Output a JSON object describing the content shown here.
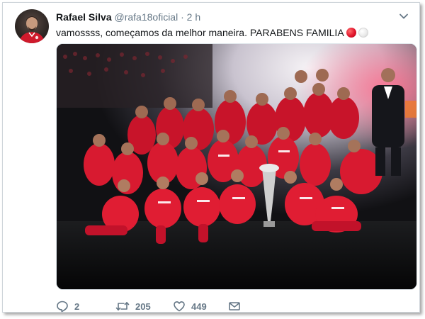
{
  "tweet": {
    "author": {
      "display_name": "Rafael Silva",
      "handle": "@rafa18oficial"
    },
    "separator": "·",
    "time": "2 h",
    "text": "vamossss, começamos da melhor maneira. PARABENS FAMILIA",
    "emoji": [
      "red-circle",
      "white-circle"
    ],
    "media": {
      "type": "photo",
      "subject": "team celebration with trophy"
    },
    "actions": {
      "reply_count": "2",
      "retweet_count": "205",
      "like_count": "449"
    }
  },
  "colors": {
    "text_primary": "#14171a",
    "text_secondary": "#657786",
    "kit_red": "#d4142a",
    "border": "#e1e8ed"
  },
  "icons": {
    "menu": "chevron-down-icon",
    "reply": "reply-icon",
    "retweet": "retweet-icon",
    "like": "heart-icon",
    "dm": "envelope-icon"
  }
}
